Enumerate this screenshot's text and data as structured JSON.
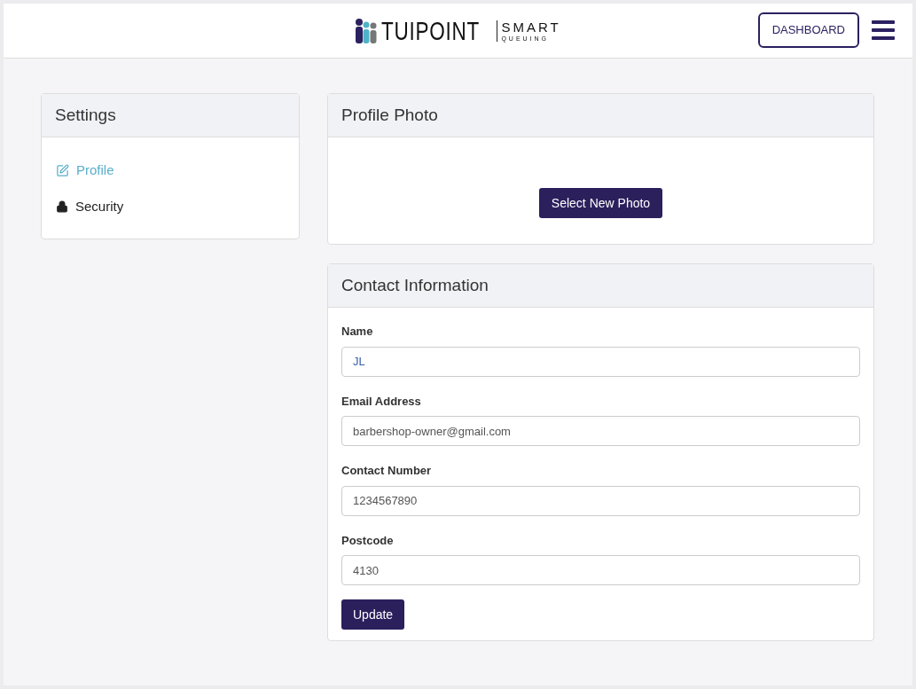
{
  "header": {
    "logo": {
      "name": "TUIPOINT",
      "tagline_top": "SMART",
      "tagline_bottom": "QUEUING"
    },
    "dashboard_button": "DASHBOARD"
  },
  "settings": {
    "title": "Settings",
    "items": [
      {
        "label": "Profile",
        "kind": "edit",
        "selected": true
      },
      {
        "label": "Security",
        "kind": "lock",
        "selected": false
      }
    ]
  },
  "profile_photo": {
    "title": "Profile Photo",
    "button": "Select New Photo"
  },
  "contact": {
    "title": "Contact Information",
    "fields": [
      {
        "label": "Name",
        "value": "JL"
      },
      {
        "label": "Email Address",
        "value": "barbershop-owner@gmail.com"
      },
      {
        "label": "Contact Number",
        "value": "1234567890"
      },
      {
        "label": "Postcode",
        "value": "4130"
      }
    ],
    "button": "Update"
  }
}
